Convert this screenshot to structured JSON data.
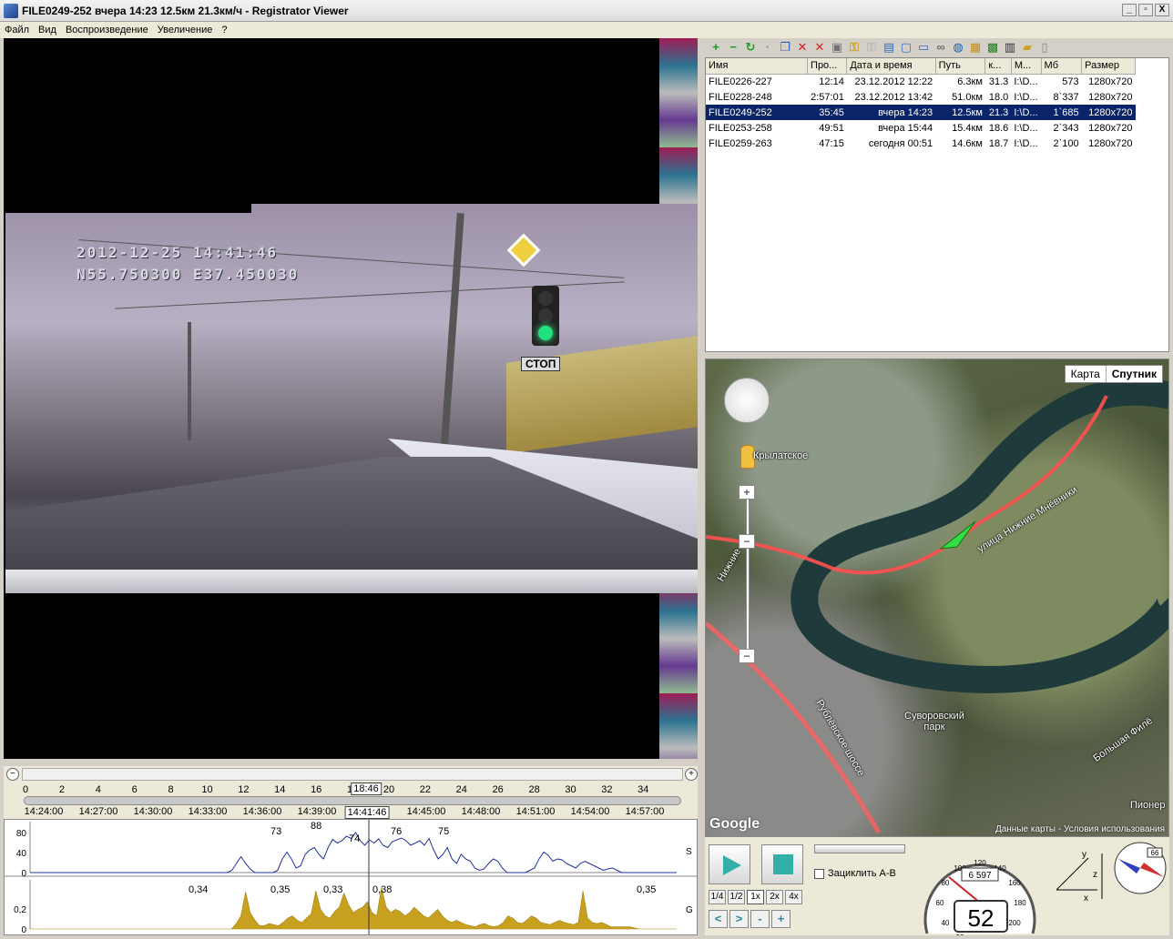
{
  "window": {
    "title": "FILE0249-252    вчера 14:23    12.5км    21.3км/ч - Registrator Viewer",
    "btn_min": "_",
    "btn_max": "▫",
    "btn_close": "X"
  },
  "menu": [
    "Файл",
    "Вид",
    "Воспроизведение",
    "Увеличение",
    "?"
  ],
  "video": {
    "osd_line1": "2012-12-25  14:41:46",
    "osd_line2": "N55.750300  E37.450030",
    "stop_sign": "СТОП"
  },
  "timeline": {
    "ticks": [
      "0",
      "2",
      "4",
      "6",
      "8",
      "10",
      "12",
      "14",
      "16",
      "18",
      "20",
      "22",
      "24",
      "26",
      "28",
      "30",
      "32",
      "34"
    ],
    "cursor_minute": "18:46",
    "times": [
      "14:24:00",
      "14:27:00",
      "14:30:00",
      "14:33:00",
      "14:36:00",
      "14:39:00",
      "14:45:00",
      "14:48:00",
      "14:51:00",
      "14:54:00",
      "14:57:00"
    ],
    "cursor_time": "14:41:46"
  },
  "graphs": {
    "speed_axis": [
      "80",
      "40",
      "0"
    ],
    "speed_side": "S",
    "speed_peaks": [
      "73",
      "88",
      "74",
      "76",
      "75"
    ],
    "g_axis": [
      "0,2",
      "0"
    ],
    "g_side": "G",
    "g_peaks": [
      "0,34",
      "0,35",
      "0,33",
      "0,38",
      "0,35"
    ]
  },
  "chart_data": [
    {
      "type": "line",
      "ylabel": "",
      "ylim": [
        0,
        100
      ],
      "series": [
        {
          "values": [
            0,
            0,
            0,
            0,
            0,
            0,
            0,
            0,
            0,
            0,
            0,
            0,
            0,
            0,
            0,
            0,
            0,
            0,
            0,
            0,
            0,
            0,
            0,
            0,
            0,
            0,
            0,
            0,
            0,
            0,
            0,
            0,
            0,
            0,
            0,
            0,
            0,
            0,
            0,
            0,
            0,
            0,
            0,
            0,
            5,
            20,
            35,
            20,
            8,
            0,
            0,
            0,
            0,
            0,
            5,
            30,
            45,
            30,
            10,
            15,
            40,
            50,
            55,
            40,
            30,
            55,
            73,
            65,
            70,
            80,
            75,
            88,
            70,
            60,
            72,
            65,
            74,
            60,
            55,
            68,
            72,
            76,
            70,
            60,
            65,
            70,
            60,
            75,
            50,
            30,
            40,
            55,
            30,
            20,
            40,
            30,
            25,
            10,
            5,
            8,
            20,
            30,
            25,
            10,
            0,
            0,
            0,
            0,
            0,
            5,
            10,
            30,
            45,
            38,
            25,
            30,
            28,
            20,
            15,
            10,
            20,
            25,
            20,
            15,
            10,
            5,
            8,
            10,
            5,
            0,
            0,
            0,
            0,
            0,
            0,
            0,
            0,
            0,
            0,
            0,
            0,
            0
          ]
        }
      ]
    },
    {
      "type": "area",
      "ylabel": "",
      "ylim": [
        0,
        0.4
      ],
      "series": [
        {
          "values": [
            0,
            0,
            0,
            0,
            0,
            0,
            0,
            0,
            0,
            0,
            0,
            0,
            0,
            0,
            0,
            0,
            0,
            0,
            0,
            0,
            0,
            0,
            0,
            0,
            0,
            0,
            0,
            0,
            0,
            0,
            0,
            0,
            0,
            0,
            0,
            0,
            0,
            0,
            0,
            0,
            0,
            0,
            0,
            0,
            0.05,
            0.12,
            0.34,
            0.15,
            0.08,
            0.03,
            0.03,
            0.05,
            0.04,
            0.03,
            0.06,
            0.1,
            0.12,
            0.08,
            0.06,
            0.1,
            0.14,
            0.35,
            0.18,
            0.12,
            0.1,
            0.16,
            0.2,
            0.33,
            0.22,
            0.15,
            0.18,
            0.2,
            0.25,
            0.15,
            0.12,
            0.38,
            0.2,
            0.15,
            0.18,
            0.16,
            0.12,
            0.15,
            0.2,
            0.16,
            0.12,
            0.1,
            0.14,
            0.18,
            0.12,
            0.08,
            0.06,
            0.08,
            0.06,
            0.04,
            0.03,
            0.02,
            0.04,
            0.05,
            0.03,
            0.02,
            0.03,
            0.06,
            0.12,
            0.1,
            0.06,
            0.05,
            0.08,
            0.12,
            0.1,
            0.06,
            0.05,
            0.04,
            0.06,
            0.08,
            0.06,
            0.05,
            0.04,
            0.06,
            0.35,
            0.1,
            0.06,
            0.05,
            0.06,
            0.04,
            0.02,
            0.02,
            0.02,
            0.02,
            0.02,
            0.01,
            0,
            0,
            0,
            0,
            0,
            0,
            0,
            0,
            0
          ]
        }
      ]
    }
  ],
  "files": {
    "columns": [
      "Имя",
      "Про...",
      "Дата и время",
      "Путь",
      "к...",
      "М...",
      "Мб",
      "Размер"
    ],
    "rows": [
      {
        "name": "FILE0226-227",
        "dur": "12:14",
        "date": "23.12.2012 12:22",
        "path": "6.3км",
        "k": "31.3",
        "m": "I:\\D...",
        "mb": "573",
        "size": "1280x720"
      },
      {
        "name": "FILE0228-248",
        "dur": "2:57:01",
        "date": "23.12.2012 13:42",
        "path": "51.0км",
        "k": "18.0",
        "m": "I:\\D...",
        "mb": "8`337",
        "size": "1280x720"
      },
      {
        "name": "FILE0249-252",
        "dur": "35:45",
        "date": "вчера 14:23",
        "path": "12.5км",
        "k": "21.3",
        "m": "I:\\D...",
        "mb": "1`685",
        "size": "1280x720"
      },
      {
        "name": "FILE0253-258",
        "dur": "49:51",
        "date": "вчера 15:44",
        "path": "15.4км",
        "k": "18.6",
        "m": "I:\\D...",
        "mb": "2`343",
        "size": "1280x720"
      },
      {
        "name": "FILE0259-263",
        "dur": "47:15",
        "date": "сегодня 00:51",
        "path": "14.6км",
        "k": "18.7",
        "m": "I:\\D...",
        "mb": "2`100",
        "size": "1280x720"
      }
    ],
    "selected_index": 2
  },
  "map": {
    "btn_map": "Карта",
    "btn_satellite": "Спутник",
    "zoom_plus": "+",
    "zoom_minus": "−",
    "labels": {
      "krylatskoe": "Крылатское",
      "street": "улица Нижние Мнёвники",
      "park": "Суворовский\nпарк",
      "rublevo": "Рублёвское шоссе",
      "bolshaya": "Большая Филё",
      "pioner": "Пионер",
      "nizhnie": "Нижние"
    },
    "google": "Google",
    "footer": "Данные карты - Условия использования"
  },
  "controls": {
    "loop_label": "Зациклить A-B",
    "rates": [
      "1/4",
      "1/2",
      "1x",
      "2x",
      "4x"
    ],
    "active_rate": "1x",
    "prev": "<",
    "next": ">",
    "zoom_out": "-",
    "zoom_in": "+",
    "odometer": "6 597",
    "speed": "52",
    "speedo_marks": [
      "20",
      "40",
      "60",
      "80",
      "100",
      "120",
      "140",
      "160",
      "180",
      "200",
      "0"
    ],
    "compass_value": "66",
    "axis_x": "x",
    "axis_y": "y",
    "axis_z": "z"
  },
  "toolbar": {
    "icons": [
      "add-icon",
      "remove-icon",
      "refresh-icon",
      "separator",
      "copy-icon",
      "delete-red-icon",
      "delete-icon",
      "save-icon",
      "key-icon",
      "key-gray-icon",
      "export-icon",
      "frame-icon",
      "frame2-icon",
      "link-icon",
      "globe-icon",
      "map-export-icon",
      "photo-icon",
      "film-icon",
      "folder-icon",
      "document-icon"
    ]
  }
}
